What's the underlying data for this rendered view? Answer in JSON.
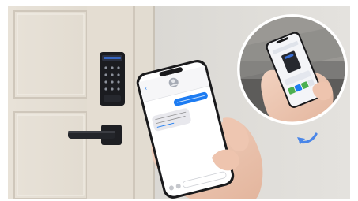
{
  "scene": {
    "description_free": true,
    "phone": {
      "contact_name": "",
      "messages": [
        {
          "from": "me",
          "text": ""
        },
        {
          "from": "them",
          "text": ""
        }
      ],
      "link_text": ""
    },
    "inset": {
      "screen_text": ""
    }
  },
  "colors": {
    "background": "#ffffff",
    "wall": "#d8d6d1",
    "door": "#e7e1d8",
    "door_shadow": "#cfc7bb",
    "lock_body": "#1b1c20",
    "keypad_glow": "#3a6fd6",
    "imessage_blue": "#1d7cf2",
    "bubble_gray": "#e8e8ed",
    "arrow_blue": "#4a86e8"
  },
  "icons": [
    "arrow-icon",
    "back-chevron-icon",
    "camera-icon",
    "appstore-icon"
  ]
}
